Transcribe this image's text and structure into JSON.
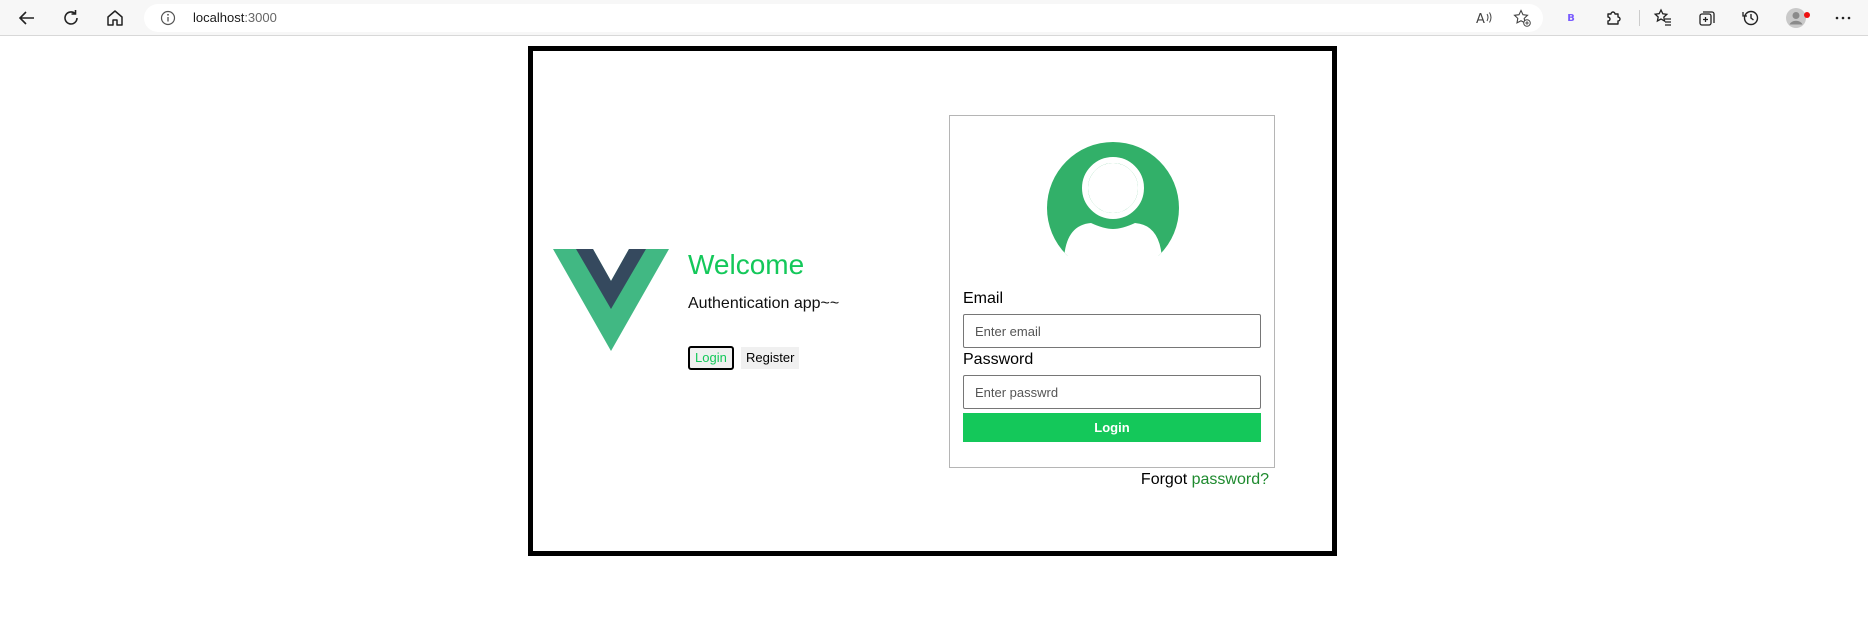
{
  "browser": {
    "url_host": "localhost",
    "url_port": ":3000",
    "extension_badge": "B"
  },
  "hero": {
    "title": "Welcome",
    "subtitle": "Authentication app~~",
    "tabs": [
      "Login",
      "Register"
    ],
    "active_tab": "Login"
  },
  "form": {
    "email_label": "Email",
    "email_placeholder": "Enter email",
    "password_label": "Password",
    "password_placeholder": "Enter passwrd",
    "submit_label": "Login"
  },
  "footer": {
    "forgot_prefix": "Forgot",
    "forgot_link": "password?"
  },
  "colors": {
    "accent": "#14c85a",
    "vue_green": "#41b883",
    "vue_dark": "#35495e",
    "avatar_green": "#32b069",
    "link_green": "#1e8a2e"
  }
}
